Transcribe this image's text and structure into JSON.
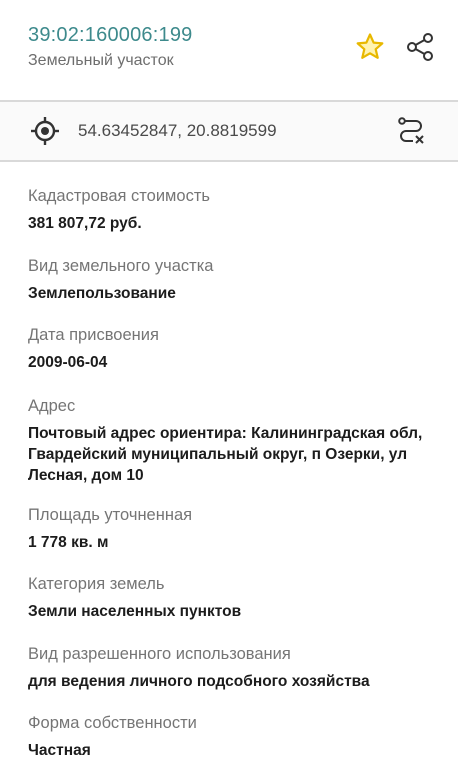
{
  "header": {
    "cadastral_number": "39:02:160006:199",
    "subtitle": "Земельный участок",
    "star_color": "#e8b800",
    "accent_color": "#3d8a8c"
  },
  "coords": {
    "value": "54.63452847, 20.8819599"
  },
  "fields": [
    {
      "label": "Кадастровая стоимость",
      "value": "381 807,72 руб."
    },
    {
      "label": "Вид земельного участка",
      "value": "Землепользование"
    },
    {
      "label": "Дата присвоения",
      "value": "2009-06-04"
    },
    {
      "label": "Адрес",
      "value": "Почтовый адрес ориентира: Калининградская обл, Гвардейский муниципальный округ, п Озерки, ул Лесная, дом 10"
    },
    {
      "label": "Площадь уточненная",
      "value": "1 778 кв. м"
    },
    {
      "label": "Категория земель",
      "value": "Земли населенных пунктов"
    },
    {
      "label": "Вид разрешенного использования",
      "value": "для ведения личного подсобного хозяйства"
    },
    {
      "label": "Форма собственности",
      "value": "Частная"
    }
  ],
  "icons": {
    "favorite": "star-icon",
    "share": "share-icon",
    "location": "crosshair-target-icon",
    "route": "route-cancel-icon"
  }
}
